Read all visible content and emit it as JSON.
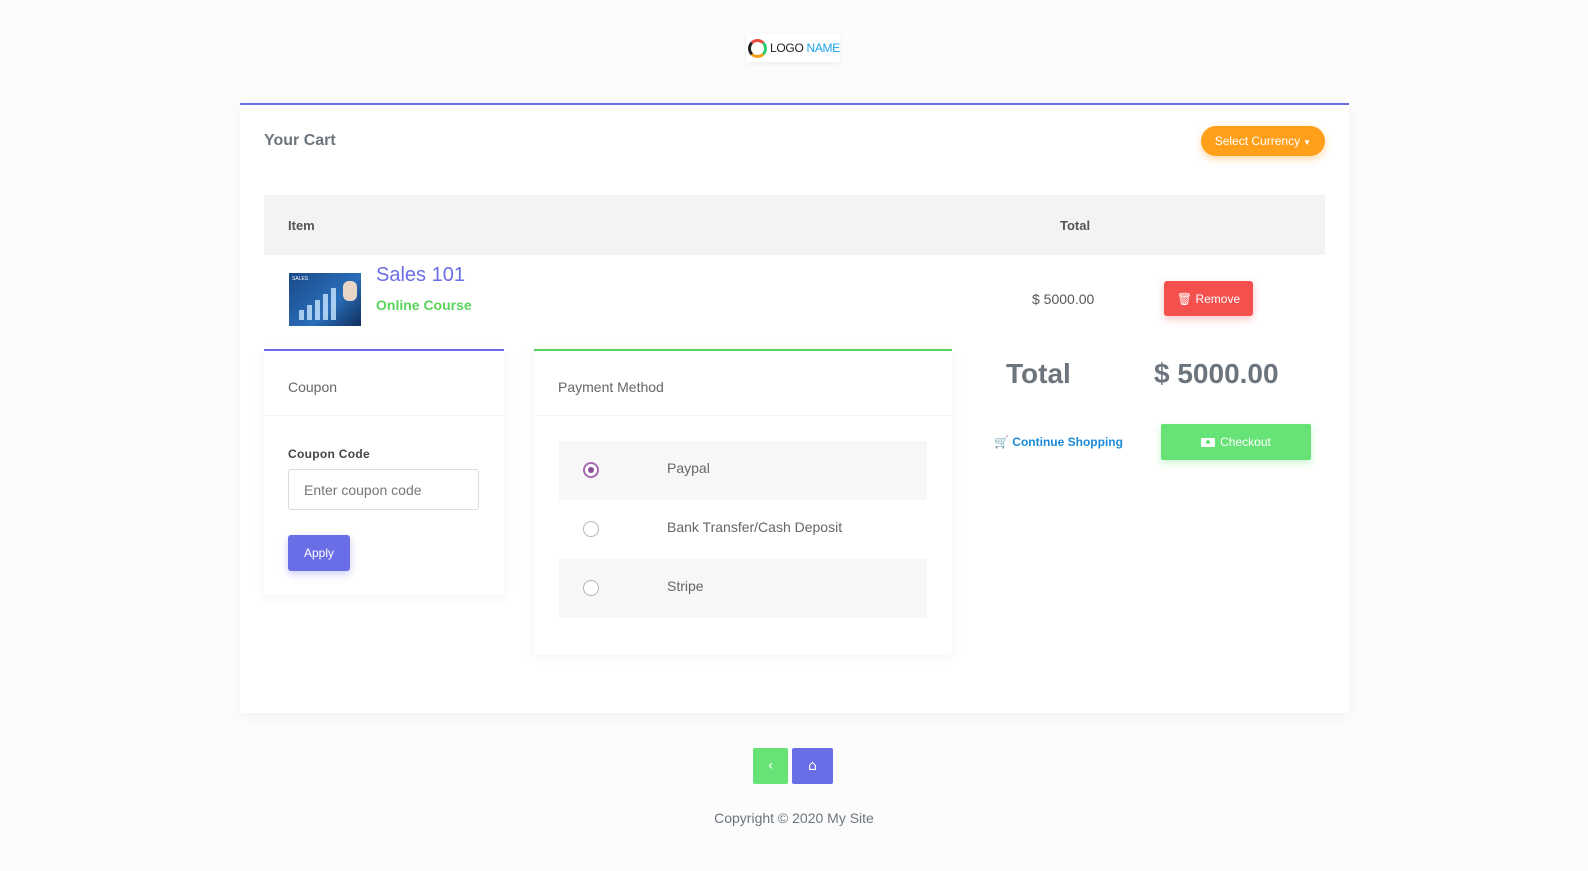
{
  "logo": {
    "text1": "LOGO",
    "text2": "NAME"
  },
  "cart": {
    "title": "Your Cart",
    "currency_button": "Select Currency",
    "columns": {
      "item": "Item",
      "total": "Total"
    },
    "item": {
      "name": "Sales 101",
      "type": "Online Course",
      "thumbnail_caption": "SALES",
      "price": "$ 5000.00",
      "remove_label": "Remove"
    },
    "summary": {
      "total_label": "Total",
      "total_value": "$ 5000.00",
      "continue_label": "Continue Shopping",
      "checkout_label": "Checkout"
    }
  },
  "coupon": {
    "title": "Coupon",
    "field_label": "Coupon Code",
    "placeholder": "Enter coupon code",
    "apply_label": "Apply"
  },
  "payment": {
    "title": "Payment Method",
    "options": [
      {
        "label": "Paypal",
        "selected": true
      },
      {
        "label": "Bank Transfer/Cash Deposit",
        "selected": false
      },
      {
        "label": "Stripe",
        "selected": false
      }
    ]
  },
  "footer": {
    "copyright": "Copyright © 2020 My Site"
  },
  "icons": {
    "back": "chevron-left-icon",
    "home": "home-icon",
    "remove": "trash-icon",
    "continue": "cart-icon",
    "checkout": "money-icon"
  },
  "colors": {
    "primary": "#6a6ee6",
    "success": "#66e276",
    "danger": "#f4514e",
    "warning": "#ff9f1a",
    "link": "#1a8ad8"
  }
}
